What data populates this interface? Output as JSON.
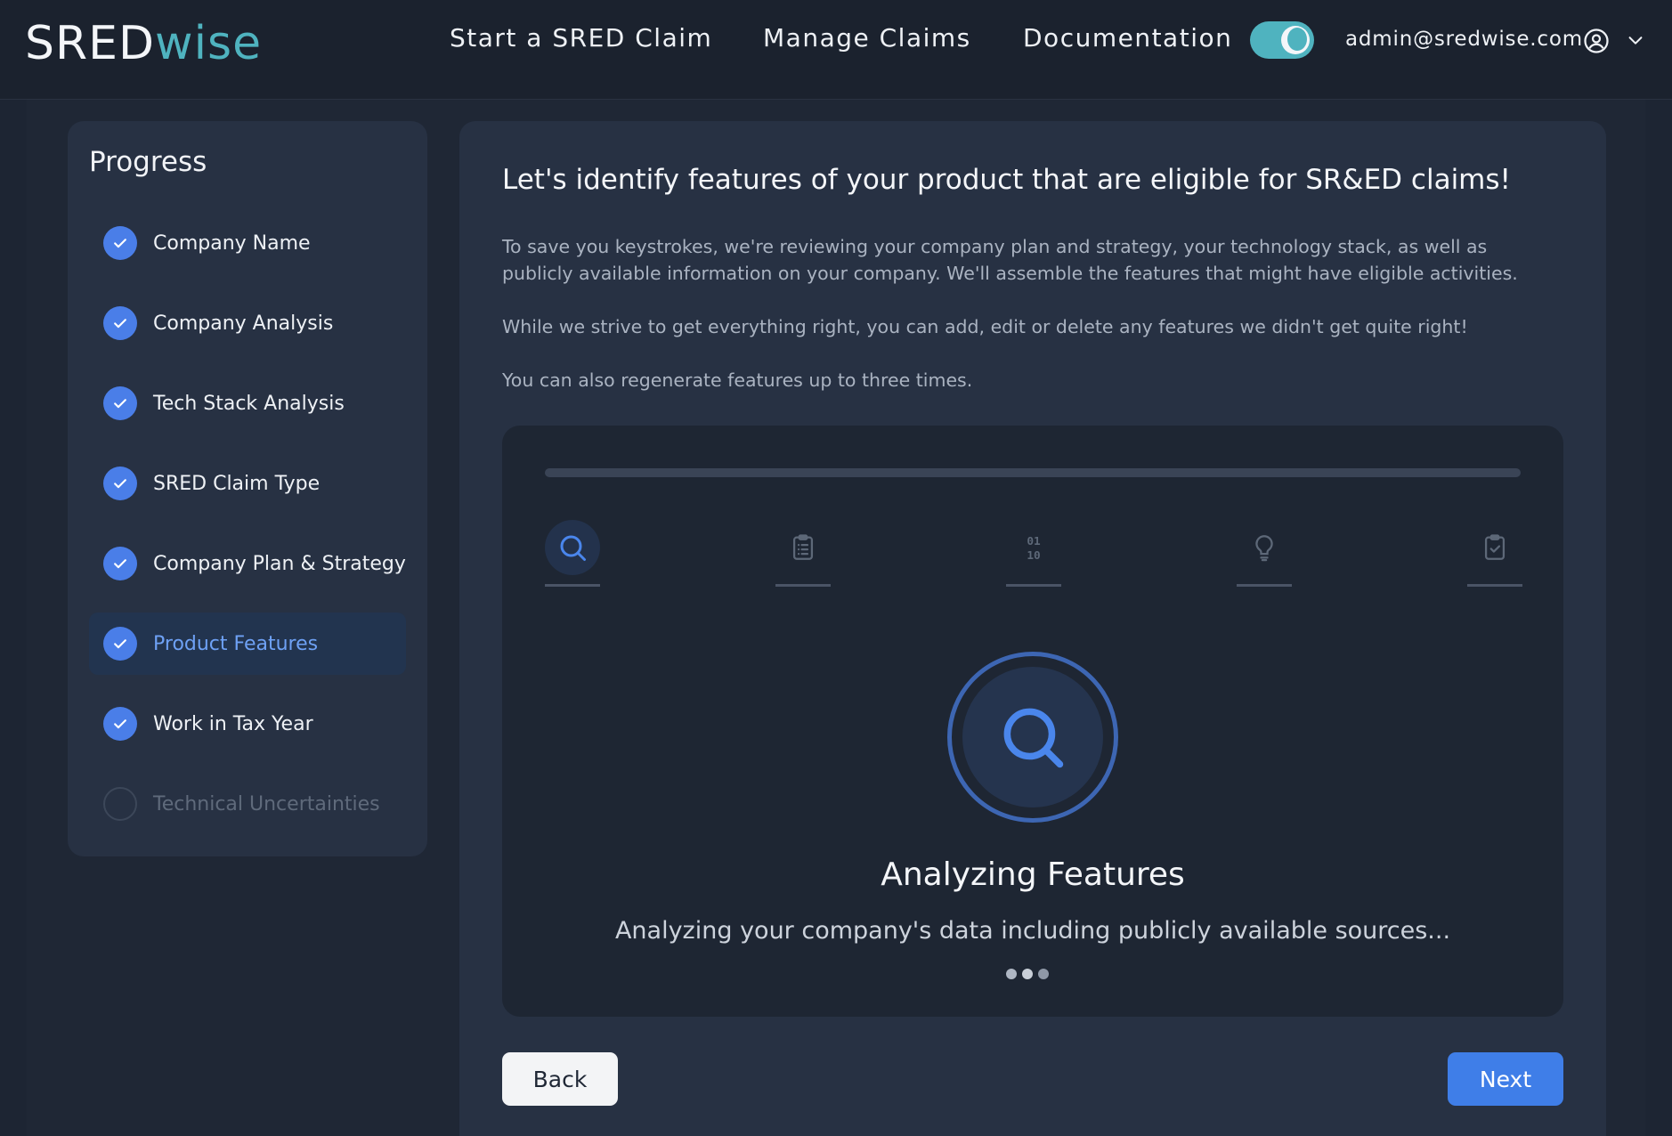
{
  "header": {
    "logo_part1": "SRED",
    "logo_part2": "wise",
    "nav": [
      {
        "label": "Start a SRED Claim"
      },
      {
        "label": "Manage Claims"
      },
      {
        "label": "Documentation"
      }
    ],
    "theme_toggle_icon": "moon-icon",
    "user_email": "admin@sredwise.com",
    "user_icon": "user-circle-icon",
    "menu_icon": "chevron-down-icon"
  },
  "sidebar": {
    "title": "Progress",
    "steps": [
      {
        "label": "Company Name",
        "status": "done"
      },
      {
        "label": "Company Analysis",
        "status": "done"
      },
      {
        "label": "Tech Stack Analysis",
        "status": "done"
      },
      {
        "label": "SRED Claim Type",
        "status": "done"
      },
      {
        "label": "Company Plan & Strategy",
        "status": "done"
      },
      {
        "label": "Product Features",
        "status": "active"
      },
      {
        "label": "Work in Tax Year",
        "status": "done"
      },
      {
        "label": "Technical Uncertainties",
        "status": "pending"
      }
    ]
  },
  "main": {
    "heading": "Let's identify features of your product that are eligible for SR&ED claims!",
    "paragraph1_line1": "To save you keystrokes, we're reviewing your company plan and strategy, your technology stack, as well as",
    "paragraph1_line2": "publicly available information on your company. We'll assemble the features that might have eligible activities.",
    "paragraph2": "While we strive to get everything right, you can add, edit or delete any features we didn't get quite right!",
    "paragraph3": "You can also regenerate features up to three times.",
    "stages": [
      {
        "icon": "search-icon",
        "active": true
      },
      {
        "icon": "clipboard-list-icon",
        "active": false
      },
      {
        "icon": "binary-icon",
        "active": false
      },
      {
        "icon": "lightbulb-icon",
        "active": false
      },
      {
        "icon": "clipboard-check-icon",
        "active": false
      }
    ],
    "binary_glyph_top": "01",
    "binary_glyph_bottom": "10",
    "status_title": "Analyzing Features",
    "status_subtitle": "Analyzing your company's data including publicly available sources...",
    "back_label": "Back",
    "next_label": "Next"
  },
  "colors": {
    "accent": "#3f7ee8",
    "brand_teal": "#4fb3bf",
    "background": "#1d2533"
  }
}
